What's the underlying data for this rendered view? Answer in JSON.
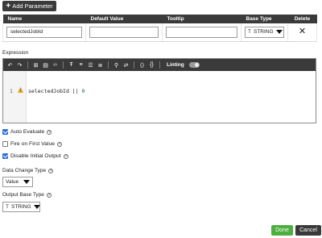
{
  "add_parameter": {
    "label": "Add Parameter",
    "icon": "plus-icon"
  },
  "params_table": {
    "headers": [
      "Name",
      "Default Value",
      "Tooltip",
      "Base Type",
      "Delete"
    ],
    "rows": [
      {
        "name": "selectedJobId",
        "default_value": "",
        "tooltip": "",
        "base_type": "STRING",
        "base_type_icon": "T"
      }
    ]
  },
  "expression": {
    "label": "Expression",
    "linting_label": "Linting",
    "line_number": "1",
    "code_before": "selectedJobId || ",
    "code_number": "0"
  },
  "options": {
    "auto_evaluate": {
      "label": "Auto Evaluate",
      "checked": true
    },
    "fire_on_first_value": {
      "label": "Fire on First Value",
      "checked": false
    },
    "disable_initial_output": {
      "label": "Disable Initial Output",
      "checked": true
    }
  },
  "data_change_type": {
    "label": "Data Change Type",
    "value": "Value"
  },
  "output_base_type": {
    "label": "Output Base Type",
    "value": "STRING",
    "icon": "T"
  },
  "actions": {
    "done": "Done",
    "cancel": "Cancel"
  },
  "colors": {
    "toolbar_bg": "#3a3a3a",
    "done_green": "#4caf3f",
    "checkbox_blue": "#2f6fd6"
  }
}
